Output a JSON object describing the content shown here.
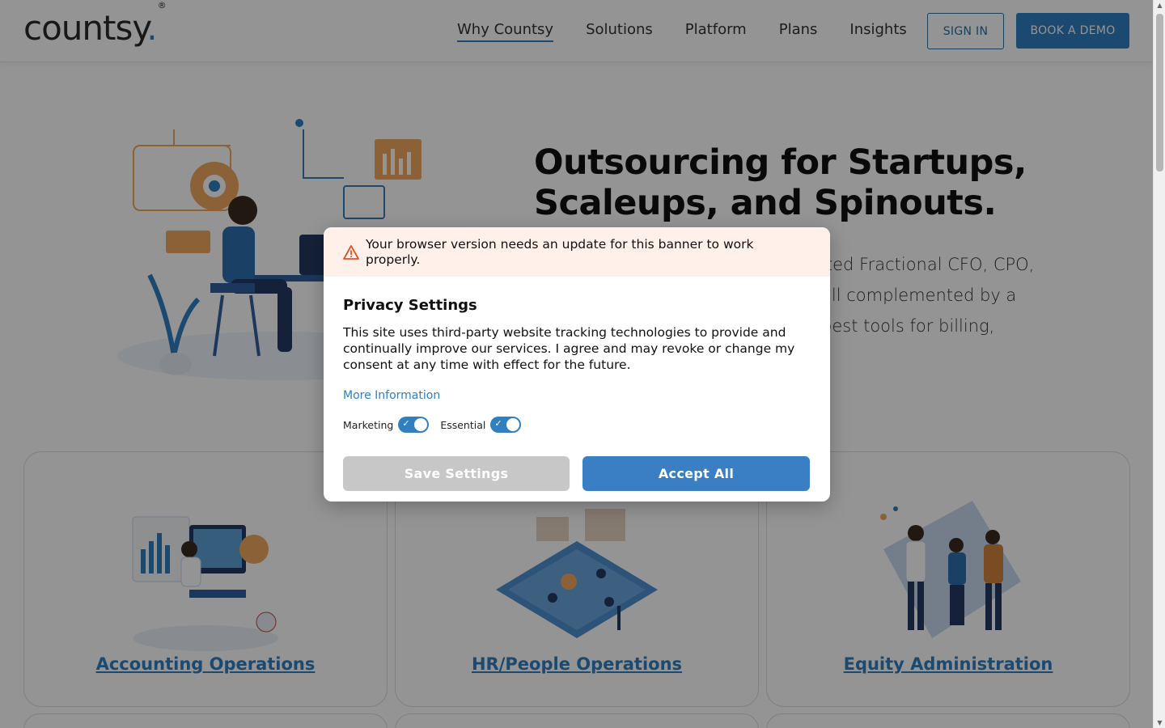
{
  "header": {
    "logo_text": "countsy",
    "logo_dot": ".",
    "logo_mark": "®",
    "nav": [
      "Why Countsy",
      "Solutions",
      "Platform",
      "Plans",
      "Insights"
    ],
    "signin_label": "SIGN IN",
    "demo_label": "BOOK A DEMO",
    "accent_color": "#2f7fc1"
  },
  "hero": {
    "title_line1": "Outsourcing for Startups,",
    "title_line2": "Scaleups, and Spinouts.",
    "text_line1": "ated Fractional CFO, CPO,",
    "text_line2": "all complemented by a",
    "text_line3": "best tools for billing,"
  },
  "cards": [
    {
      "title": "Accounting Operations"
    },
    {
      "title": "HR/People Operations"
    },
    {
      "title": "Equity Administration"
    }
  ],
  "modal": {
    "warning_icon": "warning-triangle-icon",
    "warning_text": "Your browser version needs an update for this banner to work properly.",
    "title": "Privacy Settings",
    "body": "This site uses third-party website tracking technologies to provide and continually improve our services. I agree and may revoke or change my consent at any time with effect for the future.",
    "more_info": "More Information",
    "toggle_marketing": "Marketing",
    "toggle_essential": "Essential",
    "save_label": "Save Settings",
    "accept_label": "Accept All",
    "warning_bg": "#fff1ea",
    "accept_color": "#3a7fc4"
  }
}
